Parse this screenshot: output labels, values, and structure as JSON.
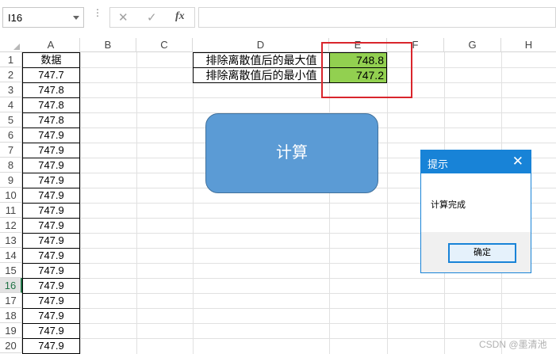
{
  "formula_bar": {
    "name_box": "I16",
    "more_glyph": "⋮",
    "cancel_glyph": "✕",
    "enter_glyph": "✓",
    "fx_label": "fx",
    "formula": ""
  },
  "columns": [
    "A",
    "B",
    "C",
    "D",
    "E",
    "F",
    "G",
    "H"
  ],
  "selected_column": "E",
  "rows": [
    "1",
    "2",
    "3",
    "4",
    "5",
    "6",
    "7",
    "8",
    "9",
    "10",
    "11",
    "12",
    "13",
    "14",
    "15",
    "16",
    "17",
    "18",
    "19",
    "20"
  ],
  "selected_row": "16",
  "column_a": [
    "数据",
    "747.7",
    "747.8",
    "747.8",
    "747.8",
    "747.9",
    "747.9",
    "747.9",
    "747.9",
    "747.9",
    "747.9",
    "747.9",
    "747.9",
    "747.9",
    "747.9",
    "747.9",
    "747.9",
    "747.9",
    "747.9",
    "747.9"
  ],
  "results": [
    {
      "label": "排除离散值后的最大值",
      "value": "748.8"
    },
    {
      "label": "排除离散值后的最小值",
      "value": "747.2"
    }
  ],
  "calc_button": {
    "label": "计算"
  },
  "dialog": {
    "title": "提示",
    "close_glyph": "✕",
    "message": "计算完成",
    "ok_label": "确定"
  },
  "watermark": "CSDN @墨清池",
  "colors": {
    "result_fill": "#92d050",
    "highlight_box": "#d9252c",
    "button_fill": "#5b9bd5",
    "dialog_accent": "#1883d7",
    "excel_green": "#217346"
  }
}
